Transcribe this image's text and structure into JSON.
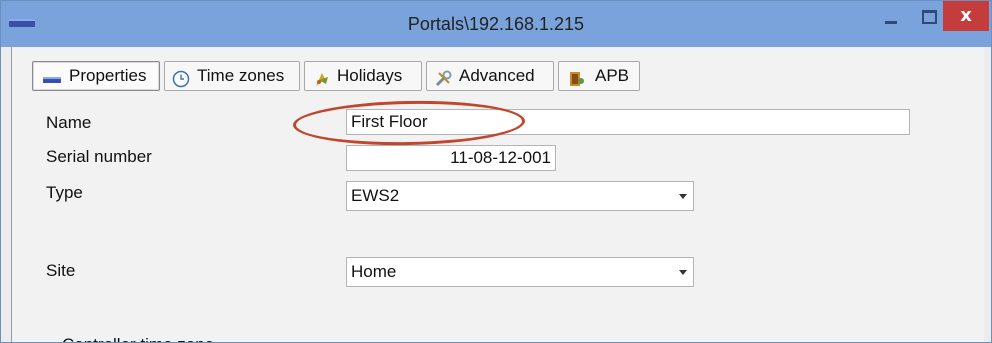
{
  "window": {
    "title": "Portals\\192.168.1.215",
    "close_glyph": "x"
  },
  "tabs": [
    {
      "label": "Properties",
      "icon": "properties-icon",
      "active": true
    },
    {
      "label": "Time zones",
      "icon": "clock-icon",
      "active": false
    },
    {
      "label": "Holidays",
      "icon": "holiday-icon",
      "active": false
    },
    {
      "label": "Advanced",
      "icon": "tools-icon",
      "active": false
    },
    {
      "label": "APB",
      "icon": "apb-icon",
      "active": false
    }
  ],
  "form": {
    "name_label": "Name",
    "name_value": "First Floor",
    "serial_label": "Serial number",
    "serial_value": "11-08-12-001",
    "type_label": "Type",
    "type_value": "EWS2",
    "site_label": "Site",
    "site_value": "Home",
    "controller_time_zone_label": "Controller time zone"
  },
  "colors": {
    "titlebar": "#7aa3dc",
    "close_button": "#c43c3c",
    "highlight_ellipse": "#c0462d"
  }
}
